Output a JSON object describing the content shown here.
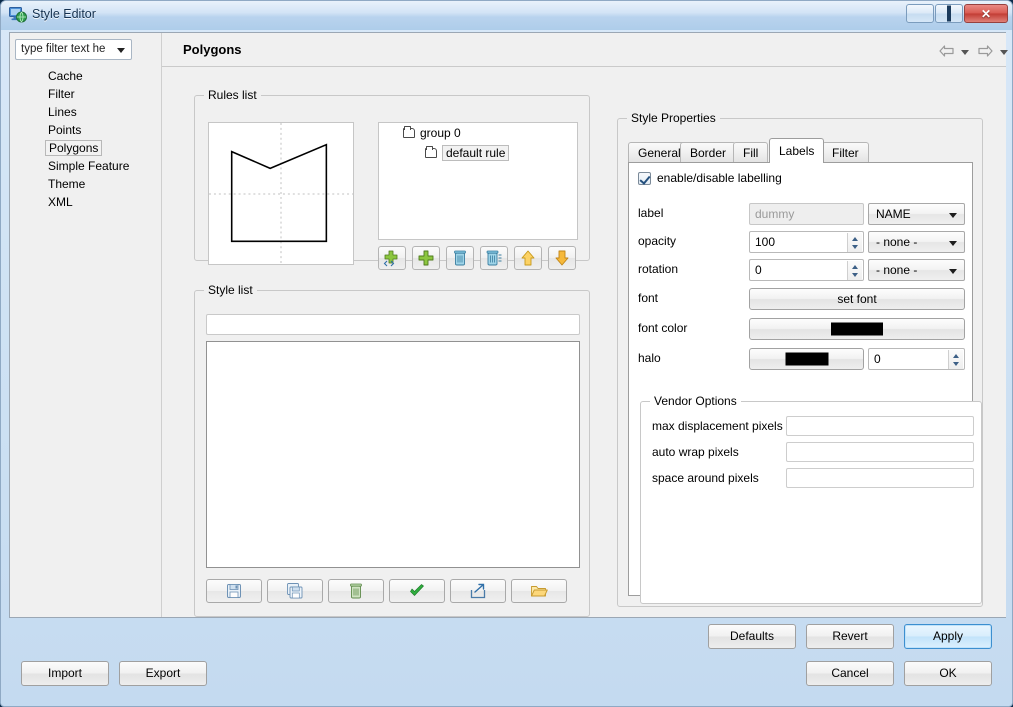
{
  "window": {
    "title": "Style Editor",
    "icon": "monitor-globe-icon",
    "minimize_label": "Minimize",
    "maximize_label": "Maximize",
    "close_label": "Close"
  },
  "sidebar": {
    "filter": {
      "value": "type filter text he",
      "placeholder": "type filter text here"
    },
    "items": [
      {
        "label": "Cache",
        "selected": false
      },
      {
        "label": "Filter",
        "selected": false
      },
      {
        "label": "Lines",
        "selected": false
      },
      {
        "label": "Points",
        "selected": false
      },
      {
        "label": "Polygons",
        "selected": true
      },
      {
        "label": "Simple Feature",
        "selected": false
      },
      {
        "label": "Theme",
        "selected": false
      },
      {
        "label": "XML",
        "selected": false
      }
    ]
  },
  "pane": {
    "title": "Polygons",
    "nav_back": "back-arrow",
    "nav_forward": "forward-arrow"
  },
  "rules_list": {
    "title": "Rules list",
    "preview_alt": "polygon-preview",
    "tree": [
      {
        "label": "group 0",
        "selected": false
      },
      {
        "label": "default rule",
        "selected": true
      }
    ],
    "toolbar": [
      {
        "name": "add-group-button",
        "icon": "add-group-icon"
      },
      {
        "name": "add-rule-button",
        "icon": "plus-icon"
      },
      {
        "name": "delete-rule-button",
        "icon": "trash-icon"
      },
      {
        "name": "delete-all-button",
        "icon": "trash-all-icon"
      },
      {
        "name": "move-up-button",
        "icon": "arrow-up-icon"
      },
      {
        "name": "move-down-button",
        "icon": "arrow-down-icon"
      }
    ]
  },
  "style_list": {
    "title": "Style list",
    "name_value": "",
    "name_placeholder": "",
    "items": [],
    "toolbar": [
      {
        "name": "save-style-button",
        "icon": "floppy-save-icon"
      },
      {
        "name": "save-as-style-button",
        "icon": "floppy-copy-icon"
      },
      {
        "name": "delete-style-button",
        "icon": "trash-icon"
      },
      {
        "name": "apply-style-button",
        "icon": "green-check-icon"
      },
      {
        "name": "export-style-button",
        "icon": "export-arrow-icon"
      },
      {
        "name": "open-style-button",
        "icon": "open-folder-icon"
      }
    ]
  },
  "style_properties": {
    "title": "Style Properties",
    "tabs": [
      {
        "label": "General",
        "active": false
      },
      {
        "label": "Border",
        "active": false
      },
      {
        "label": "Fill",
        "active": false
      },
      {
        "label": "Labels",
        "active": true
      },
      {
        "label": "Filter",
        "active": false
      }
    ],
    "labels_tab": {
      "enable_checkbox": {
        "label": "enable/disable labelling",
        "checked": true
      },
      "rows": [
        {
          "label": "label",
          "field_value": "",
          "field_placeholder": "dummy",
          "field_disabled": true,
          "combo_value": "NAME"
        },
        {
          "label": "opacity",
          "field_value": "100",
          "spinner": true,
          "combo_value": "- none -"
        },
        {
          "label": "rotation",
          "field_value": "0",
          "spinner": true,
          "combo_value": "- none -"
        }
      ],
      "font_label": "font",
      "font_button": "set font",
      "font_color_label": "font color",
      "font_color_value": "#000000",
      "halo_label": "halo",
      "halo_color_value": "#000000",
      "halo_width_value": "0"
    },
    "vendor_options": {
      "title": "Vendor Options",
      "fields": [
        {
          "label": "max displacement pixels",
          "value": ""
        },
        {
          "label": "auto wrap pixels",
          "value": ""
        },
        {
          "label": "space around pixels",
          "value": ""
        }
      ]
    }
  },
  "footer": {
    "defaults": "Defaults",
    "revert": "Revert",
    "apply": "Apply",
    "import": "Import",
    "export": "Export",
    "cancel": "Cancel",
    "ok": "OK"
  },
  "colors": {
    "accent": "#3c8fd0",
    "titlebar": "#aecdea",
    "panel": "#f0f0f0",
    "black_swatch": "#000000"
  }
}
